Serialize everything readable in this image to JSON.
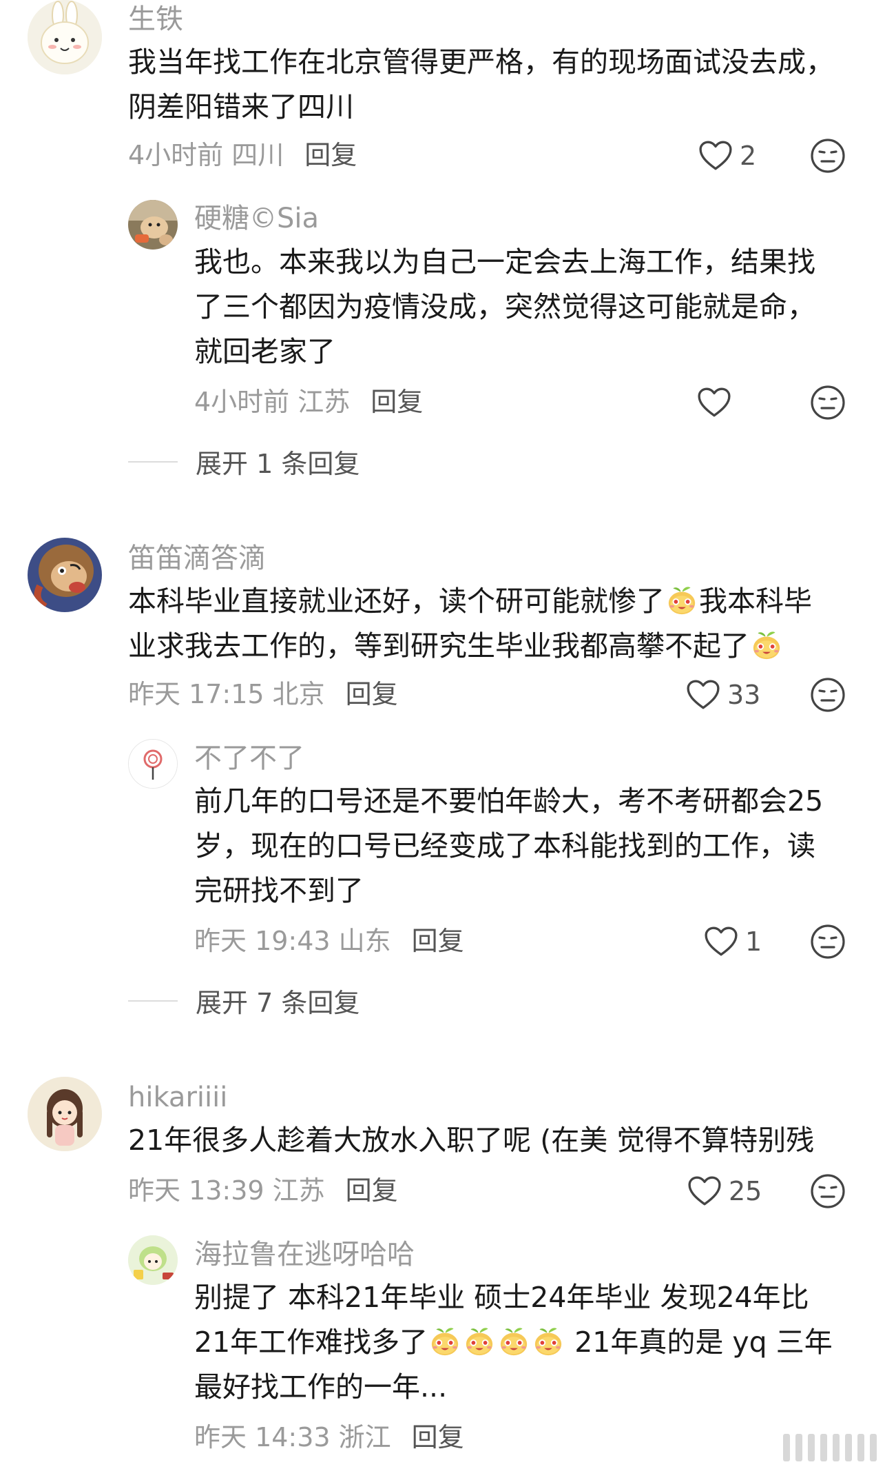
{
  "comments": [
    {
      "username": "生铁",
      "lines": [
        "我当年找工作在北京管得更严格，有的现场面试没去成，",
        "阴差阳错来了四川"
      ],
      "time": "4小时前 四川",
      "reply": "回复",
      "likes": "2",
      "replies": [
        {
          "username": "硬糖©Sia",
          "lines": [
            "我也。本来我以为自己一定会去上海工作，结果找",
            "了三个都因为疫情没成，突然觉得这可能就是命，",
            "就回老家了"
          ],
          "time": "4小时前 江苏",
          "reply": "回复",
          "likes": ""
        }
      ],
      "expand": "展开 1 条回复"
    },
    {
      "username": "笛笛滴答滴",
      "lines": [
        "本科毕业直接就业还好，读个研可能就惨了",
        "我本科毕",
        "业求我去工作的，等到研究生毕业我都高攀不起了"
      ],
      "time": "昨天 17:15 北京",
      "reply": "回复",
      "likes": "33",
      "replies": [
        {
          "username": "不了不了",
          "lines": [
            "前几年的口号还是不要怕年龄大，考不考研都会25",
            "岁，现在的口号已经变成了本科能找到的工作，读",
            "完研找不到了"
          ],
          "time": "昨天 19:43 山东",
          "reply": "回复",
          "likes": "1"
        }
      ],
      "expand": "展开 7 条回复"
    },
    {
      "username": "hikariiii",
      "lines": [
        "21年很多人趁着大放水入职了呢 (在美 觉得不算特别残"
      ],
      "time": "昨天 13:39 江苏",
      "reply": "回复",
      "likes": "25",
      "replies": [
        {
          "username": "海拉鲁在逃呀哈哈",
          "lines": [
            "别提了 本科21年毕业 硕士24年毕业 发现24年比",
            "21年工作难找多了",
            " 21年真的是 yq 三年",
            "最好找工作的一年..."
          ],
          "time": "昨天 14:33 浙江",
          "reply": "回复",
          "likes": ""
        }
      ]
    }
  ],
  "icons": {
    "like": "heart-outline-icon",
    "dislike": "neutral-face-icon",
    "emoji": "sprout-face-emoji"
  },
  "colors": {
    "text": "#1a1a1a",
    "secondary": "#9a9a9a",
    "action": "#555555"
  }
}
